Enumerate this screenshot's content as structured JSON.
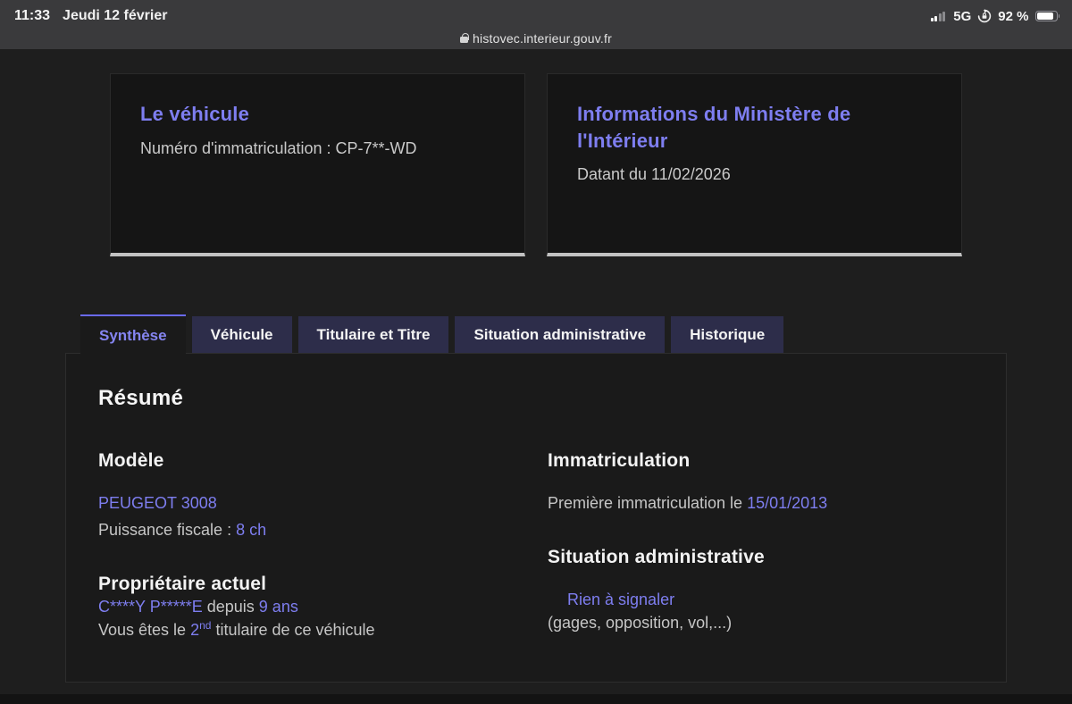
{
  "status_bar": {
    "time": "11:33",
    "date": "Jeudi 12 février",
    "network": "5G",
    "battery": "92 %",
    "icons": {
      "cellular": "cellular-signal-icon",
      "rotation_lock": "orientation-lock-icon",
      "battery": "battery-icon"
    }
  },
  "url_bar": {
    "lock": "lock-icon",
    "url": "histovec.interieur.gouv.fr"
  },
  "cards": [
    {
      "title": "Le véhicule",
      "body": "Numéro d'immatriculation : CP-7**-WD"
    },
    {
      "title": "Informations du Ministère de l'Intérieur",
      "body": "Datant du 11/02/2026"
    }
  ],
  "tabs": [
    {
      "label": "Synthèse",
      "active": true
    },
    {
      "label": "Véhicule",
      "active": false
    },
    {
      "label": "Titulaire et Titre",
      "active": false
    },
    {
      "label": "Situation administrative",
      "active": false
    },
    {
      "label": "Historique",
      "active": false
    }
  ],
  "panel": {
    "heading": "Résumé",
    "left": {
      "model": {
        "heading": "Modèle",
        "name": "PEUGEOT 3008",
        "fiscal_label": "Puissance fiscale : ",
        "fiscal_value": "8 ch"
      },
      "owner": {
        "heading": "Propriétaire actuel",
        "owner_name": "C****Y P*****E",
        "since_label": " depuis ",
        "since_value": "9 ans",
        "holder_prefix": "Vous êtes le ",
        "holder_rank": "2",
        "holder_rank_sup": "nd",
        "holder_suffix": " titulaire de ce véhicule"
      }
    },
    "right": {
      "registration": {
        "heading": "Immatriculation",
        "label": "Première immatriculation le ",
        "date": "15/01/2013"
      },
      "situation": {
        "heading": "Situation administrative",
        "status": "Rien à signaler",
        "note": "(gages, opposition, vol,...)"
      }
    }
  },
  "colors": {
    "accent_purple": "#7e7ef0",
    "tab_active_border": "#6a6af4",
    "inactive_tab_bg": "#2d2d4a",
    "card_bottom_border": "#c2c2c2",
    "topbar_bg": "#3a3a3c"
  }
}
